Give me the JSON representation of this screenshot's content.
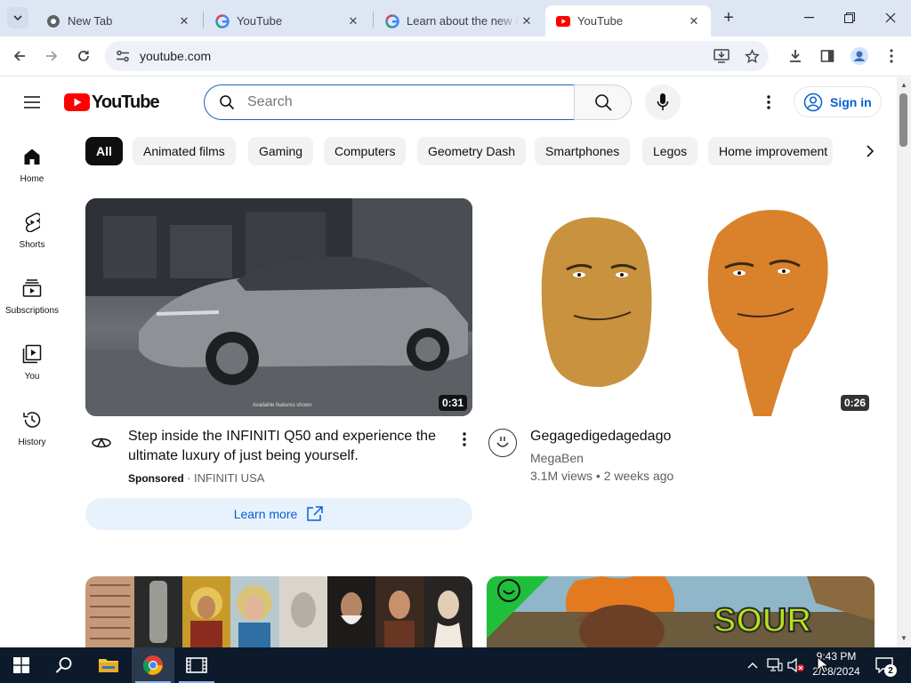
{
  "browser": {
    "tabs": [
      {
        "title": "New Tab",
        "icon": "chrome-icon"
      },
      {
        "title": "YouTube",
        "icon": "google-icon"
      },
      {
        "title": "Learn about the new G",
        "icon": "google-icon"
      },
      {
        "title": "YouTube",
        "icon": "youtube-icon",
        "active": true
      }
    ],
    "url": "youtube.com"
  },
  "youtube": {
    "logo_text": "YouTube",
    "search": {
      "placeholder": "Search"
    },
    "signin_label": "Sign in",
    "chips": [
      "All",
      "Animated films",
      "Gaming",
      "Computers",
      "Geometry Dash",
      "Smartphones",
      "Legos",
      "Home improvement"
    ],
    "nav": [
      {
        "label": "Home",
        "icon": "home-icon"
      },
      {
        "label": "Shorts",
        "icon": "shorts-icon"
      },
      {
        "label": "Subscriptions",
        "icon": "subscriptions-icon"
      },
      {
        "label": "You",
        "icon": "you-icon"
      },
      {
        "label": "History",
        "icon": "history-icon"
      }
    ],
    "videos": [
      {
        "title": "Step inside the INFINITI Q50 and experience the ultimate luxury of just being yourself.",
        "duration": "0:31",
        "sponsored": "Sponsored",
        "channel": "INFINITI USA",
        "cta": "Learn more",
        "thumb_caption": "Available features shown"
      },
      {
        "title": "Gegagedigedagedago",
        "duration": "0:26",
        "channel": "MegaBen",
        "stats": "3.1M views • 2 weeks ago"
      }
    ],
    "colors": {
      "brand_red": "#ff0000",
      "link_blue": "#065fd4"
    }
  },
  "taskbar": {
    "time": "9:43 PM",
    "date": "2/28/2024",
    "notification_count": "2"
  }
}
